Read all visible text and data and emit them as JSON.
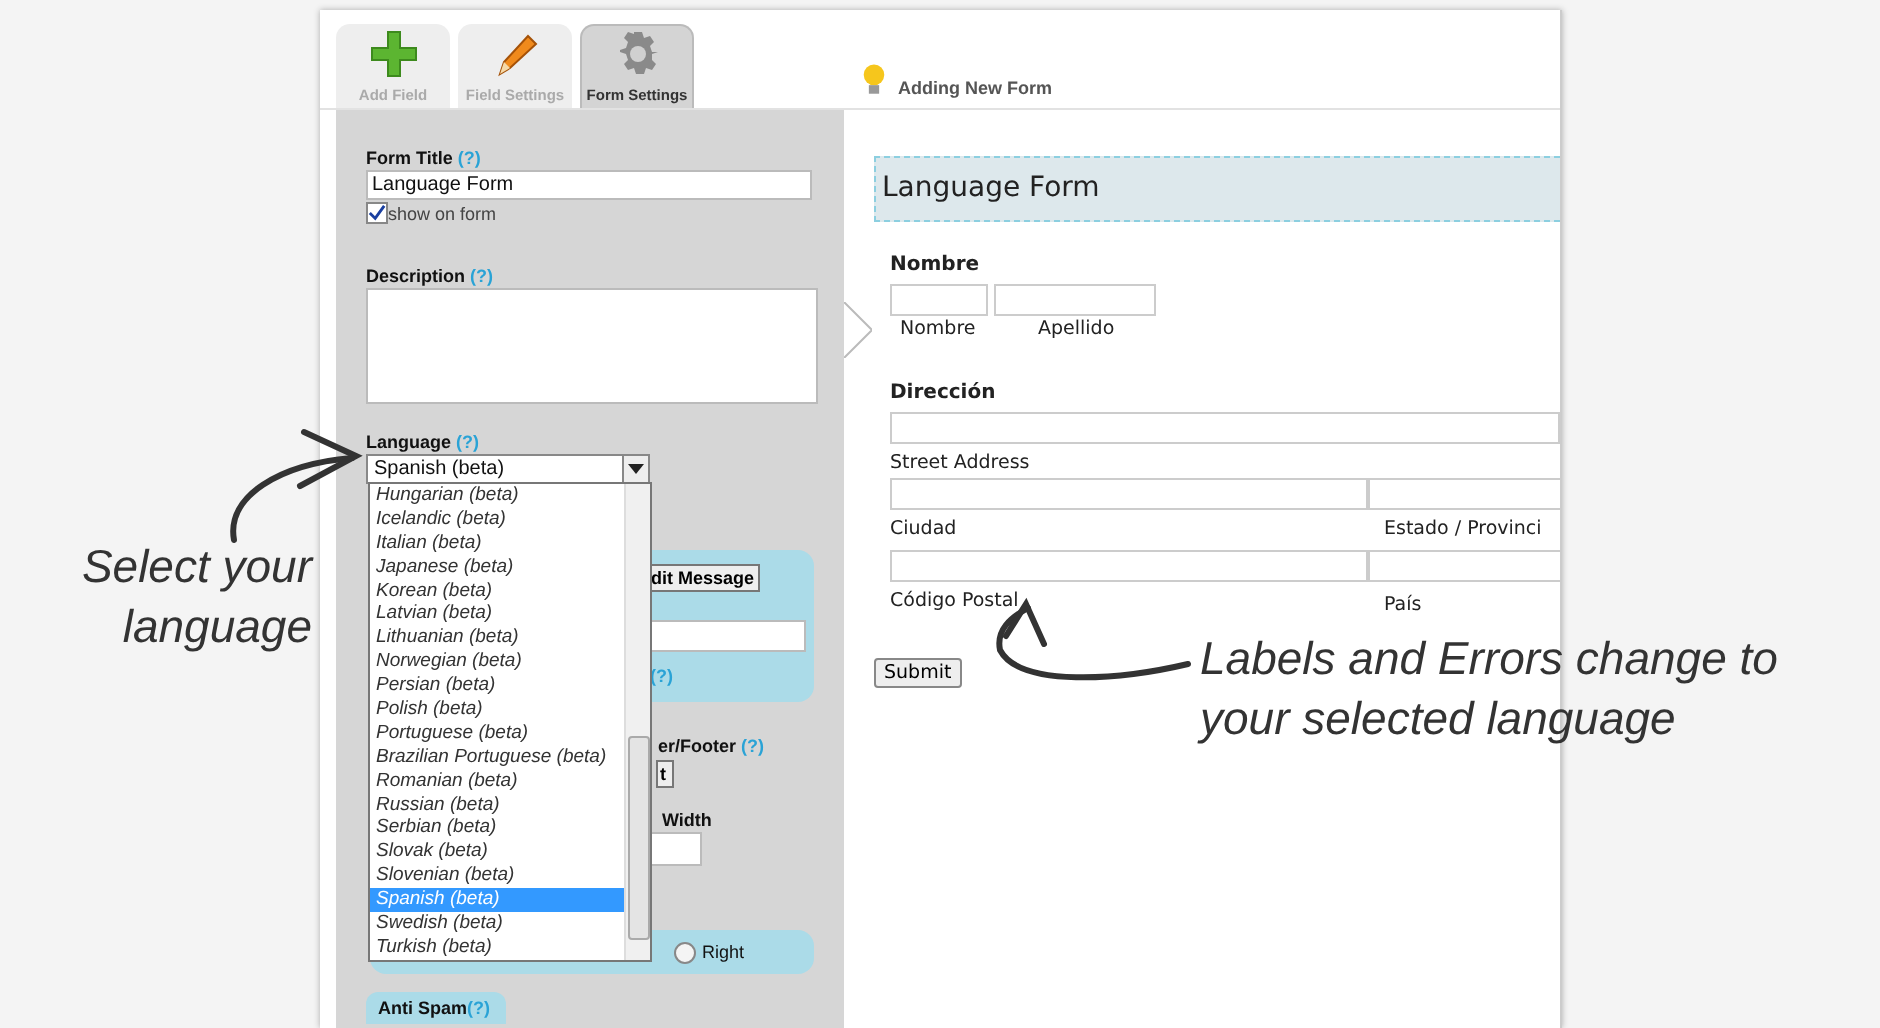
{
  "toolbar": {
    "tabs": [
      {
        "label": "Add Field",
        "kind": "add",
        "selected": false
      },
      {
        "label": "Field Settings",
        "kind": "edit",
        "selected": false
      },
      {
        "label": "Form Settings",
        "kind": "settings",
        "selected": true
      }
    ],
    "status": "Adding New Form"
  },
  "settings": {
    "form_title": {
      "label": "Form Title",
      "help": "(?)",
      "value": "Language Form"
    },
    "show_on_form": {
      "label": "show on form",
      "checked": true
    },
    "description": {
      "label": "Description",
      "help": "(?)"
    },
    "language": {
      "label": "Language",
      "help": "(?)",
      "value": "Spanish (beta)",
      "options": [
        {
          "label": "Hungarian (beta)",
          "selected": false
        },
        {
          "label": "Icelandic (beta)",
          "selected": false
        },
        {
          "label": "Italian (beta)",
          "selected": false
        },
        {
          "label": "Japanese (beta)",
          "selected": false
        },
        {
          "label": "Korean (beta)",
          "selected": false
        },
        {
          "label": "Latvian (beta)",
          "selected": false
        },
        {
          "label": "Lithuanian (beta)",
          "selected": false
        },
        {
          "label": "Norwegian (beta)",
          "selected": false
        },
        {
          "label": "Persian (beta)",
          "selected": false
        },
        {
          "label": "Polish (beta)",
          "selected": false
        },
        {
          "label": "Portuguese (beta)",
          "selected": false
        },
        {
          "label": "Brazilian Portuguese (beta)",
          "selected": false
        },
        {
          "label": "Romanian (beta)",
          "selected": false
        },
        {
          "label": "Russian (beta)",
          "selected": false
        },
        {
          "label": "Serbian (beta)",
          "selected": false
        },
        {
          "label": "Slovak (beta)",
          "selected": false
        },
        {
          "label": "Slovenian (beta)",
          "selected": false
        },
        {
          "label": "Spanish (beta)",
          "selected": true
        },
        {
          "label": "Swedish (beta)",
          "selected": false
        },
        {
          "label": "Turkish (beta)",
          "selected": false
        }
      ]
    },
    "partly_hidden": {
      "button_1": "dit Message",
      "help_1": "(?)",
      "label_1": "er/Footer",
      "help_2": "(?)",
      "button_2": "t",
      "label_2": "Width",
      "radio": {
        "label": "Right",
        "selected": false
      }
    },
    "anti_spam": {
      "label": "Anti Spam",
      "help": "(?)"
    }
  },
  "preview": {
    "title": "Language Form",
    "name": {
      "label": "Nombre",
      "sublabels": [
        "Nombre",
        "Apellido"
      ]
    },
    "address": {
      "label": "Dirección",
      "street": "Street Address",
      "city": "Ciudad",
      "state": "Estado / Provinci",
      "postal": "Código Postal",
      "country": "País"
    },
    "submit": "Submit"
  },
  "annotations": [
    {
      "lines": [
        "Select your",
        "language"
      ]
    },
    {
      "lines": [
        "Labels and Errors change to",
        "your selected language"
      ]
    }
  ]
}
